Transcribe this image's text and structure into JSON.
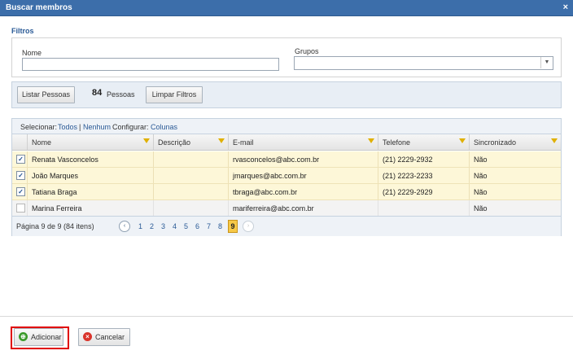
{
  "dialog": {
    "title": "Buscar membros",
    "close_glyph": "×"
  },
  "filters": {
    "heading": "Filtros",
    "name_label": "Nome",
    "name_value": "",
    "groups_label": "Grupos",
    "groups_value": "",
    "groups_arrow": "▼"
  },
  "toolbar": {
    "list_button": "Listar Pessoas",
    "count": "84",
    "count_label": "Pessoas",
    "clear_button": "Limpar Filtros"
  },
  "grid": {
    "select_label": "Selecionar:",
    "select_all": "Todos",
    "separator": "|",
    "select_none": "Nenhum",
    "configure_label": "Configurar:",
    "configure_columns": "Colunas",
    "columns": [
      "Nome",
      "Descrição",
      "E-mail",
      "Telefone",
      "Sincronizado"
    ],
    "rows": [
      {
        "checked": "✓",
        "nome": "Renata Vasconcelos",
        "descricao": "",
        "email": "rvasconcelos@abc.com.br",
        "telefone": "(21) 2229-2932",
        "sincronizado": "Não"
      },
      {
        "checked": "✓",
        "nome": "João Marques",
        "descricao": "",
        "email": "jmarques@abc.com.br",
        "telefone": "(21) 2223-2233",
        "sincronizado": "Não"
      },
      {
        "checked": "✓",
        "nome": "Tatiana Braga",
        "descricao": "",
        "email": "tbraga@abc.com.br",
        "telefone": "(21) 2229-2929",
        "sincronizado": "Não"
      },
      {
        "checked": "",
        "nome": "Marina Ferreira",
        "descricao": "",
        "email": "mariferreira@abc.com.br",
        "telefone": "",
        "sincronizado": "Não"
      }
    ]
  },
  "pager": {
    "info": "Página 9 de 9 (84 itens)",
    "prev_glyph": "‹",
    "next_glyph": "›",
    "pages": [
      "1",
      "2",
      "3",
      "4",
      "5",
      "6",
      "7",
      "8",
      "9"
    ],
    "current_page": "9"
  },
  "footer": {
    "add_button": "Adicionar",
    "add_icon": "⊕",
    "cancel_button": "Cancelar",
    "cancel_icon": "×"
  },
  "colors": {
    "title_bar": "#3c6eaa",
    "link": "#2a5a96",
    "selected_row": "#fdf7d8",
    "current_page": "#f7c948",
    "add_icon": "#3a9a2a",
    "cancel_icon": "#d9342b",
    "focus_ring": "#e00000"
  }
}
